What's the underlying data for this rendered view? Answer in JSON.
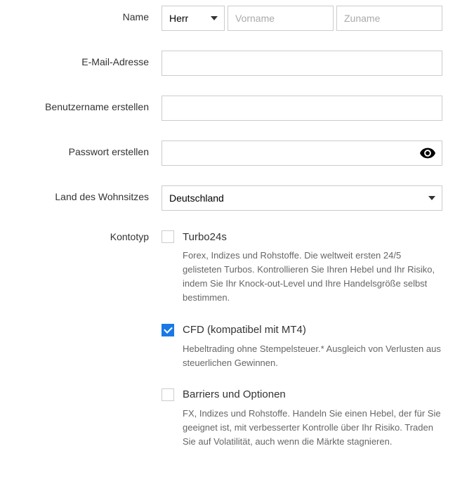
{
  "labels": {
    "name": "Name",
    "email": "E-Mail-Adresse",
    "username": "Benutzername erstellen",
    "password": "Passwort erstellen",
    "country": "Land des Wohnsitzes",
    "accountType": "Kontotyp"
  },
  "fields": {
    "salutation": "Herr",
    "firstnamePlaceholder": "Vorname",
    "lastnamePlaceholder": "Zuname",
    "emailValue": "",
    "usernameValue": "",
    "passwordValue": "",
    "countrySelected": "Deutschland"
  },
  "accountTypes": {
    "turbo24s": {
      "title": "Turbo24s",
      "description": "Forex, Indizes und Rohstoffe. Die weltweit ersten 24/5 gelisteten Turbos. Kontrollieren Sie Ihren Hebel und Ihr Risiko, indem Sie Ihr Knock-out-Level und Ihre Handelsgröße selbst bestimmen.",
      "checked": false
    },
    "cfd": {
      "title": "CFD (kompatibel mit MT4)",
      "description": "Hebeltrading ohne Stempelsteuer.* Ausgleich von Verlusten aus steuerlichen Gewinnen.",
      "checked": true
    },
    "barriers": {
      "title": "Barriers und Optionen",
      "description": "FX, Indizes und Rohstoffe. Handeln Sie einen Hebel, der für Sie geeignet ist, mit verbesserter Kontrolle über Ihr Risiko. Traden Sie auf Volatilität, auch wenn die Märkte stagnieren.",
      "checked": false
    }
  }
}
